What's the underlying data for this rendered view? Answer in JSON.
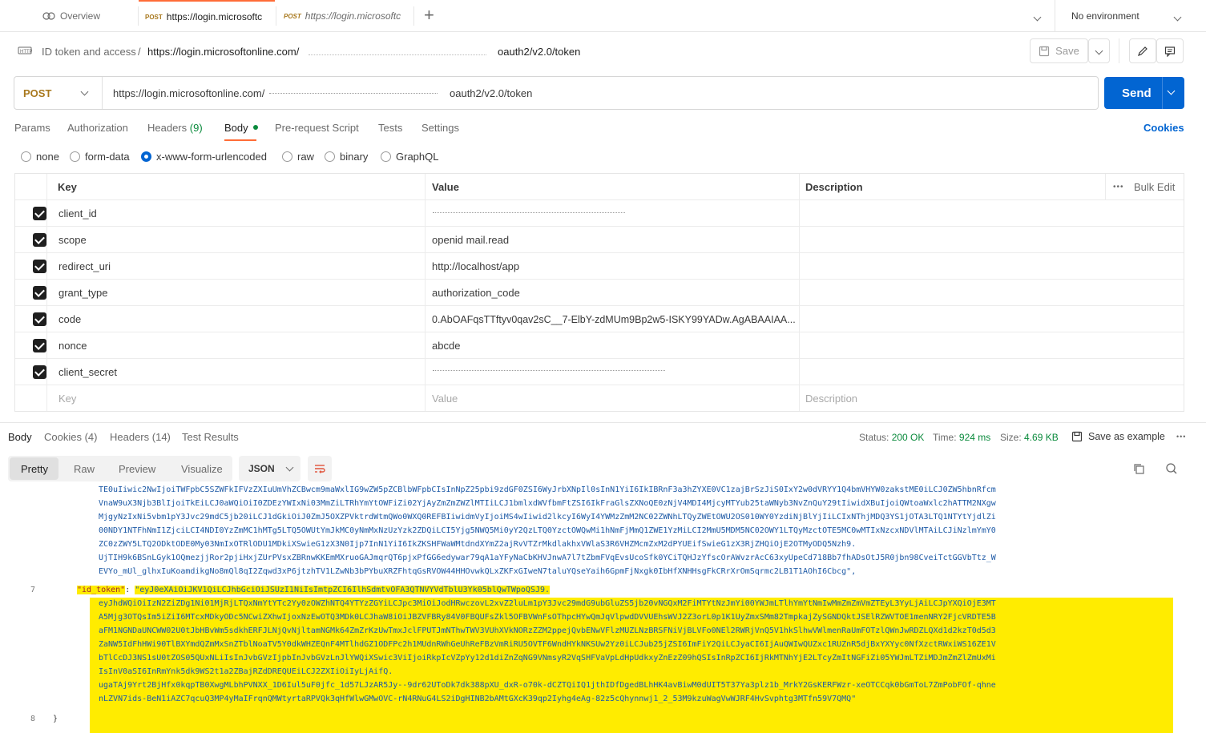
{
  "tabs": [
    {
      "method": "",
      "label": "Overview"
    },
    {
      "method": "POST",
      "label": "https://login.microsoftc"
    },
    {
      "method": "POST",
      "label": "https://login.microsoftc"
    }
  ],
  "env": {
    "label": "No environment"
  },
  "breadcrumb": {
    "parent": "ID token and access",
    "sep": "/",
    "url_start": "https://login.microsoftonline.com/",
    "url_end": "oauth2/v2.0/token"
  },
  "toolbar": {
    "save_label": "Save"
  },
  "request": {
    "method": "POST",
    "url_start": "https://login.microsoftonline.com/",
    "url_end": "oauth2/v2.0/token",
    "send_label": "Send"
  },
  "req_tabs": [
    "Params",
    "Authorization",
    "Headers",
    "Body",
    "Pre-request Script",
    "Tests",
    "Settings"
  ],
  "headers_count": "(9)",
  "cookies_link": "Cookies",
  "body_types": [
    "none",
    "form-data",
    "x-www-form-urlencoded",
    "raw",
    "binary",
    "GraphQL"
  ],
  "table": {
    "headers": {
      "key": "Key",
      "value": "Value",
      "description": "Description",
      "bulk": "Bulk Edit",
      "more": "•••"
    },
    "rows": [
      {
        "key": "client_id",
        "value": ""
      },
      {
        "key": "scope",
        "value": "openid mail.read"
      },
      {
        "key": "redirect_uri",
        "value": "http://localhost/app"
      },
      {
        "key": "grant_type",
        "value": "authorization_code"
      },
      {
        "key": "code",
        "value": "0.AbOAFqsTTftyv0qav2sC__7-ElbY-zdMUm9Bp2w5-ISKY99YADw.AgABAAIAA..."
      },
      {
        "key": "nonce",
        "value": "abcde"
      },
      {
        "key": "client_secret",
        "value": ""
      }
    ],
    "placeholder": {
      "key": "Key",
      "value": "Value",
      "description": "Description"
    }
  },
  "response": {
    "tabs": [
      "Body",
      "Cookies",
      "Headers",
      "Test Results"
    ],
    "cookies_count": "(4)",
    "headers_count": "(14)",
    "status_label": "Status:",
    "status": "200 OK",
    "time_label": "Time:",
    "time": "924 ms",
    "size_label": "Size:",
    "size": "4.69 KB",
    "save_example": "Save as example",
    "more": "•••",
    "views": [
      "Pretty",
      "Raw",
      "Preview",
      "Visualize"
    ],
    "format": "JSON"
  },
  "code": {
    "prev_lines": [
      "TE0uIiwic2NwIjoiTWFpbC5SZWFkIFVzZXIuUmVhZCBwcm9maWxlIG9wZW5pZCBlbWFpbCIsInNpZ25pbi9zdGF0ZSI6WyJrbXNpIl0sInN1YiI6IkIBRnF3a3hZYXE0VC1zajBrSzJiS0IxY2w0dVRYY1Q4bmVHYW0zakstME0iLCJ0ZW5hbnRfcm",
      "VnaW9uX3Njb3BlIjoiTkEiLCJ0aWQiOiI0ZDEzYWIxNi03MmZiLTRhYmYtOWFiZi02YjAyZmZmZWZlMTIiLCJ1bmlxdWVfbmFtZSI6IkFraGlsZXNoQE0zNjV4MDI4MjcyMTYub25taWNyb3NvZnQuY29tIiwidXBuIjoiQWtoaWxlc2hATTM2NXgw",
      "MjgyNzIxNi5vbm1pY3Jvc29mdC5jb20iLCJ1dGkiOiJ0ZmJ5OXZPVktrdWtmQWo0WXQ0REFBIiwidmVyIjoiMS4wIiwid2lkcyI6WyI4YWMzZmM2NC02ZWNhLTQyZWEtOWU2OS010WY0YzdiNjBlYjIiLCIxNThjMDQ3YS1jOTA3LTQ1NTYtYjdlZi",
      "00NDY1NTFhNmI1ZjciLCI4NDI0YzZmMC1hMTg5LTQ5OWUtYmJkMC0yNmMxNzUzYzk2ZDQiLCI5Yjg5NWQ5Mi0yY2QzLTQ0YzctOWQwMi1hNmFjMmQ1ZWE1YzMiLCI2MmU5MDM5NC02OWY1LTQyMzctOTE5MC0wMTIxNzcxNDVlMTAiLCJiNzlmYmY0",
      "ZC0zZWY5LTQ2ODktODE0My03NmIxOTRlODU1MDkiXSwieG1zX3N0Ijp7InN1YiI6IkZKSHFWaWMtdndXYmZ2ajRvVTZrMkdlakhxVWlaS3R6VHZMcmZxM2dPYUEifSwieG1zX3RjZHQiOjE2OTMyODQ5Nzh9.",
      "UjTIH9k6BSnLGyk1OQmezjjRor2pjiHxjZUrPVsxZBRnwKKEmMXruoGAJmqrQT6pjxPfGG6edywar79qA1aYFyNaCbKHVJnwA7l7tZbmFVqEvsUcoSfk0YCiTQHJzYfscOrAWvzrAcC63xyUpeCd718Bb7fhADsOtJ5R0jbn98CveiTctGGVbTtz_W",
      "EVYo_mUl_glhxIuKoamdikgNo8mQl8qI2Zqwd3xP6jtzhTV1LZwNb3bPYbuXRZFhtqGsRVOW44HHOvwkQLxZKFxGIweN7taluYQseYaih6GpmFjNxgk0IbHfXNHHsgFkCRrXrOmSqrmc2LB1T1AOhI6Cbcg\","
    ],
    "line7_num": "7",
    "key": "\"id_token\"",
    "colon": ": ",
    "token_lines": [
      "\"eyJ0eXAiOiJKV1QiLCJhbGciOiJSUzI1NiIsImtpZCI6IlhSdmtvOFA3QTNVYVdTblU3Yk05blQwTWpoQSJ9.",
      "eyJhdWQiOiIzN2ZiZDg1Ni01MjRjLTQxNmYtYTc2Yy0zOWZhNTQ4YTYzZGYiLCJpc3MiOiJodHRwczovL2xvZ2luLm1pY3Jvc29mdG9ubGluZS5jb20vNGQxM2FiMTYtNzJmYi00YWJmLTlhYmYtNmIwMmZmZmVmZTEyL3YyLjAiLCJpYXQiOjE3MT",
      "A5Mjg3OTQsIm5iZiI6MTcxMDkyODc5NCwiZXhwIjoxNzEwOTQ3MDk0LCJhaW8iOiJBZVFBRy84V0FBQUFsZkl5OFBVWnFsOThpcHYwQmJqVlpwdDVVUEhsWVJ2Z3orL0p1K1UyZmxSMm82TmpkajZySGNDQktJSElRZWVTOE1menNRY2FjcVRDTE5B",
      "aFM1NGNDaUNCWW02U0tJbHBvWm5sdkhERFJLNjQvNjltamNGMk64ZmZrKzUwTmxJclFPUTJmNThwTWV3VUhXVkNORzZZM2ppejQvbENwVFlzMUZLNzBRSFNiVjBLVFo0NEl2RWRjVnQ5V1hkSlhwVWlmenRaUmFOTzlQWnJwRDZLQXd1d2kzT0d5d3",
      "ZaNW5IdFhHWi90TlBXYmdQZmMxSnZTblNoaTV5Y0dkWHZEQnF4MTlhdGZ1ODFPc2h1MUdnRWhGeUhReFBzVmRiRU5OVTF6WndHYkNKSUw2Yz0iLCJub25jZSI6ImFiY2QiLCJyaCI6IjAuQWIwQUZxc1RUZnR5djBxYXYyc0NfXzctRWxiWS16ZE1V",
      "bTlCcDJ3NS1sU0tZOS05QUxNLiIsInJvbGVzIjpbInJvbGVzLnJlYWQiXSwic3ViIjoiRkpIcVZpYy12d1diZnZqNG9VNmsyR2VqSHFVaVpLdHpUdkxyZnEzZ09hQSIsInRpZCI6IjRkMTNhYjE2LTcyZmItNGFiZi05YWJmLTZiMDJmZmZlZmUxMi",
      "IsInV0aSI6InRmYnk5dk9WS2t1a2ZBajRZdDREQUEiLCJ2ZXIiOiIyLjAifQ.",
      "ugaTAj9Yrt2BjHfx0kqpTB0XwgMLbhPVNXX_1D6Iul5uF0jfc_1d57LJzAR5Jy--9dr62UToDk7dk388pXU_dxR-o70k-dCZTQiIQ1jthIDfDgedBLhHK4avBiwM0dUIT5T37Ya3plz1b_MrkY2GsKERFWzr-xeOTCCqk0bGmToL7ZmPobFOf-qhne",
      "nLZVN7ids-BeN1iAZC7qcuQ3MP4yMaIFrqnQMWtyrtaRPVQk3qHfWlwGMwOVC-rN4RNuG4LS2iDgHINB2bAMtGXcK39qp2Iyhg4eAg-82z5cQhynnwj1_2_53M9kzuWagVwWJRF4HvSvphtg3MTfn59V7QMQ\""
    ],
    "line8_num": "8",
    "line8_text": "}"
  }
}
